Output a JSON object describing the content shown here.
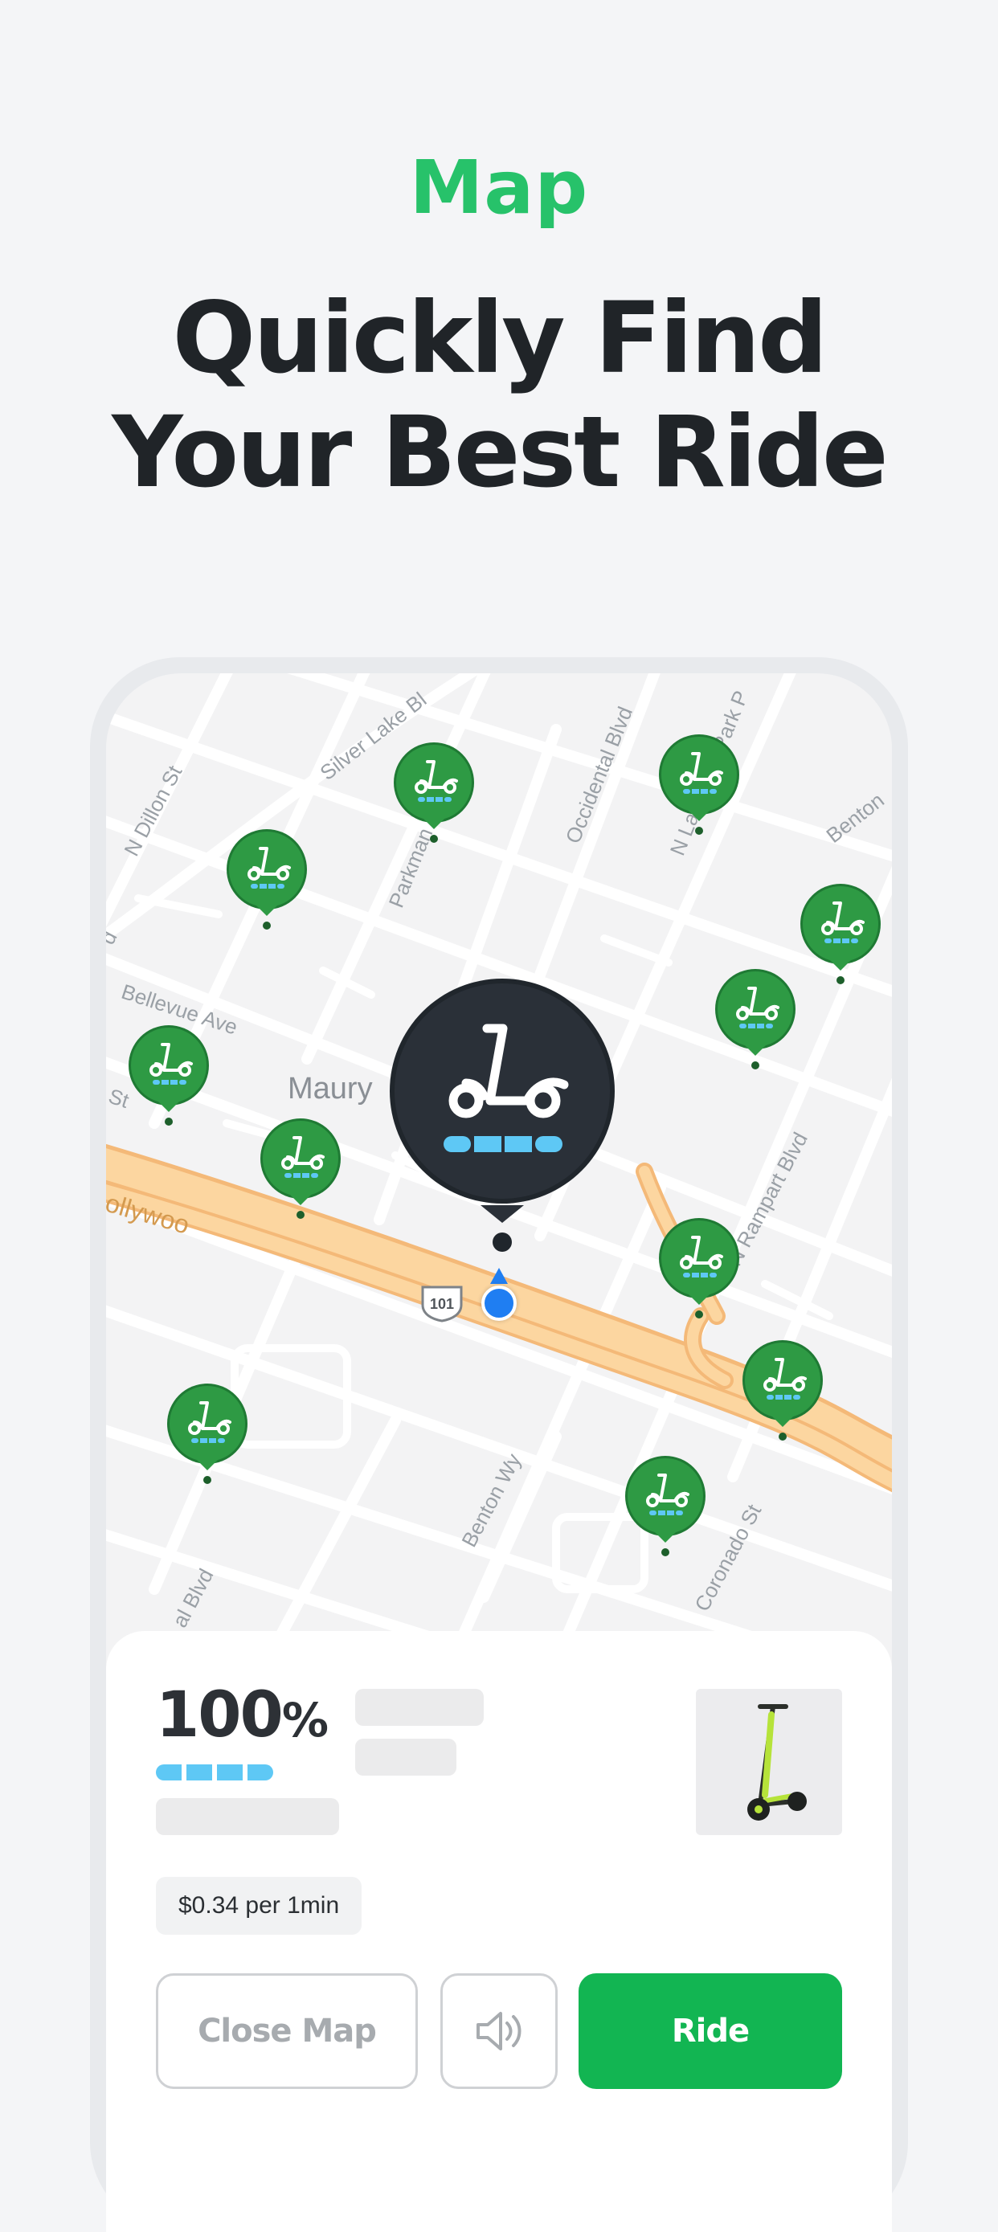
{
  "header": {
    "eyebrow": "Map",
    "headline_line1": "Quickly Find",
    "headline_line2": "Your Best Ride"
  },
  "map": {
    "area_label": "Maury",
    "street_labels": [
      "Silver Lake Bl",
      "Occidental Blvd",
      "N Lafayette Park P",
      "Benton",
      "N Dillon St",
      "Parkman",
      "Bellevue Ave",
      "St",
      "ollywoo",
      "N Rampart Blvd",
      "Benton Wy",
      "Coronado St",
      "al Blvd",
      "d"
    ],
    "highway_shield": "101",
    "vehicle_icon": "scooter-icon",
    "selected_vehicle_icon": "scooter-icon",
    "user_location_icon": "location-dot-icon",
    "nearby_scooter_count": 11,
    "colors": {
      "pin_green": "#2e9a44",
      "selected_pin": "#262c33",
      "battery_blue": "#5ec8f5",
      "highway": "#fbcf8e"
    }
  },
  "vehicle_card": {
    "battery_value": "100",
    "battery_unit": "%",
    "battery_level_segments": 4,
    "price": "$0.34 per 1min",
    "photo_icon": "scooter-photo",
    "close_map_label": "Close Map",
    "sound_icon": "speaker-icon",
    "ride_label": "Ride",
    "colors": {
      "ride_button": "#12b552",
      "accent_text": "#27c26a"
    }
  }
}
